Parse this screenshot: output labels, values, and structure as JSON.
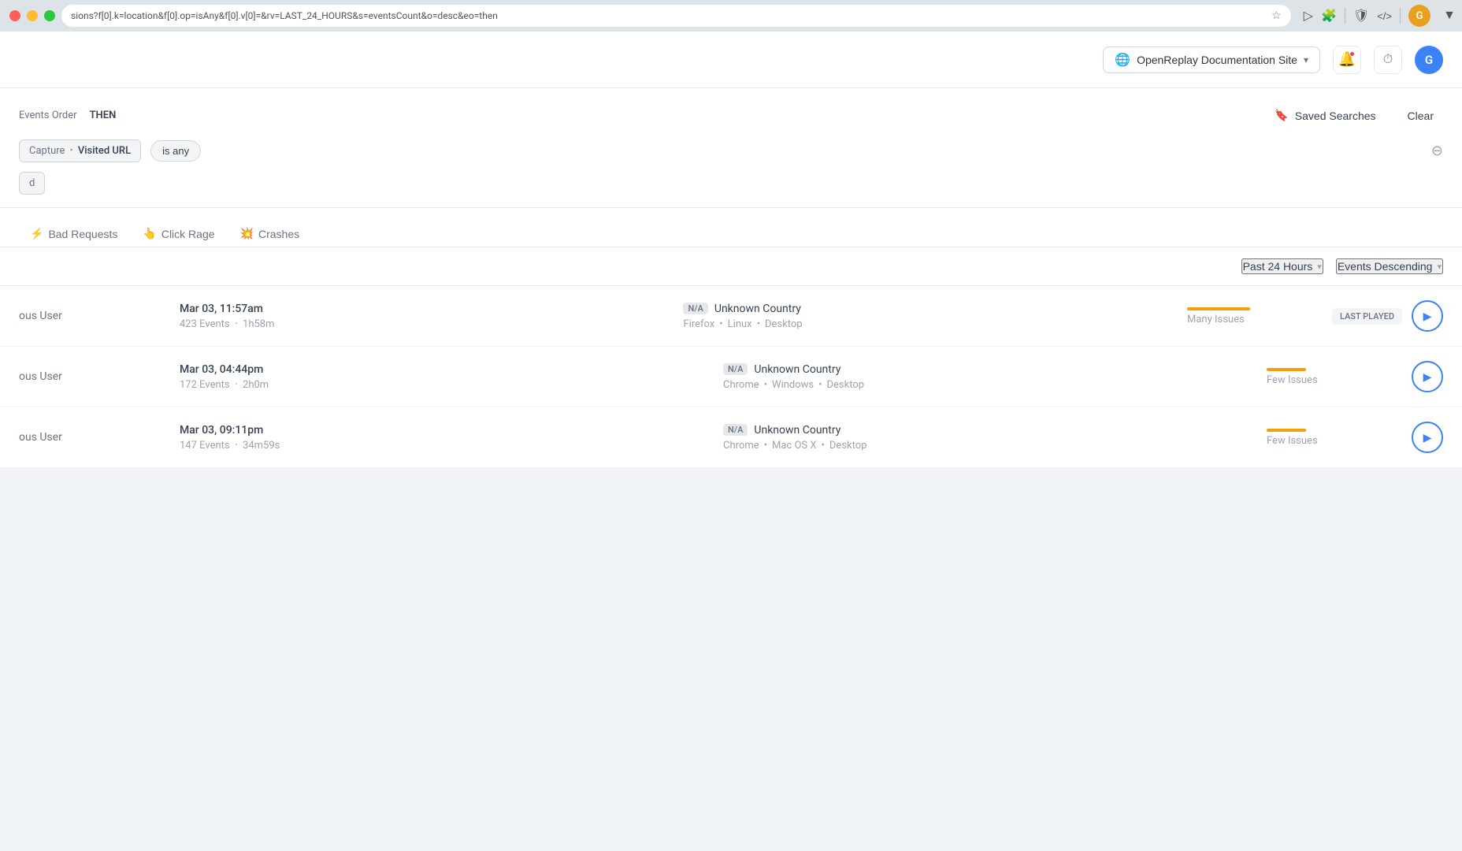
{
  "browser": {
    "url": "sions?f[0].k=location&f[0].op=isAny&f[0].v[0]=&rv=LAST_24_HOURS&s=eventsCount&o=desc&eo=then",
    "extend_label": "▼"
  },
  "header": {
    "site_name": "OpenReplay Documentation Site",
    "notification_label": "🔔",
    "history_label": "⏱",
    "user_initial": "G"
  },
  "filter": {
    "events_order_label": "Events Order",
    "events_order_value": "THEN",
    "saved_searches_label": "Saved Searches",
    "clear_label": "Clear",
    "filter1": {
      "capture_label": "Capture",
      "separator": "•",
      "url_label": "Visited URL",
      "condition": "is any"
    },
    "remove_icon": "−"
  },
  "tabs": {
    "items": [
      {
        "id": "bad-requests",
        "icon": "⚡",
        "label": "Bad Requests"
      },
      {
        "id": "click-rage",
        "icon": "👆",
        "label": "Click Rage"
      },
      {
        "id": "crashes",
        "icon": "💥",
        "label": "Crashes"
      }
    ]
  },
  "sort_bar": {
    "time_label": "Past 24 Hours",
    "sort_label": "Events Descending",
    "chevron": "▾"
  },
  "sessions": [
    {
      "user": "ous User",
      "time": "Mar 03, 11:57am",
      "events": "423 Events",
      "duration": "1h58m",
      "country_badge": "N/A",
      "country": "Unknown Country",
      "browser": "Firefox",
      "os": "Linux",
      "device": "Desktop",
      "issue_size": "many",
      "issue_label": "Many Issues",
      "last_played": true,
      "last_played_label": "LAST PLAYED"
    },
    {
      "user": "ous User",
      "time": "Mar 03, 04:44pm",
      "events": "172 Events",
      "duration": "2h0m",
      "country_badge": "N/A",
      "country": "Unknown Country",
      "browser": "Chrome",
      "os": "Windows",
      "device": "Desktop",
      "issue_size": "few",
      "issue_label": "Few Issues",
      "last_played": false,
      "last_played_label": ""
    },
    {
      "user": "ous User",
      "time": "Mar 03, 09:11pm",
      "events": "147 Events",
      "duration": "34m59s",
      "country_badge": "N/A",
      "country": "Unknown Country",
      "browser": "Chrome",
      "os": "Mac OS X",
      "device": "Desktop",
      "issue_size": "few",
      "issue_label": "Few Issues",
      "last_played": false,
      "last_played_label": ""
    }
  ],
  "icons": {
    "star": "☆",
    "play_video": "▶",
    "extensions": "🧩",
    "devtools": "</>",
    "shield": "🛡",
    "more": "⋮",
    "globe": "🌐",
    "bell": "🔔",
    "clock": "⏱",
    "bookmark": "🔖",
    "minus_circle": "⊖",
    "play": "▶",
    "wifi_slash": "⚡",
    "cursor": "👆",
    "crash": "💥"
  }
}
